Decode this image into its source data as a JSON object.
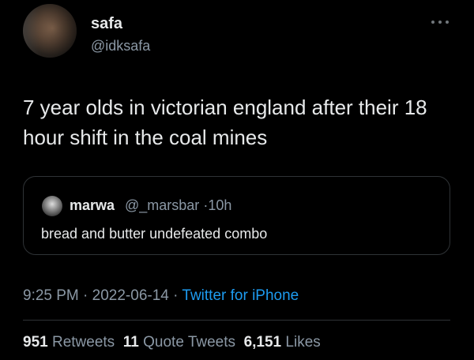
{
  "author": {
    "display_name": "safa",
    "handle": "@idksafa"
  },
  "tweet": {
    "text": "7 year olds in victorian england after their 18 hour shift in the coal mines"
  },
  "quoted_tweet": {
    "display_name": "marwa",
    "handle": "@_marsbar",
    "time_ago": "10h",
    "text": "bread and butter undefeated combo"
  },
  "meta": {
    "time": "9:25 PM",
    "date": "2022-06-14",
    "source": "Twitter for iPhone",
    "separator": "·"
  },
  "stats": {
    "retweets_count": "951",
    "retweets_label": "Retweets",
    "quotes_count": "11",
    "quotes_label": "Quote Tweets",
    "likes_count": "6,151",
    "likes_label": "Likes"
  },
  "icons": {
    "more": "more-options-icon"
  },
  "colors": {
    "background": "#000000",
    "text": "#e7e9ea",
    "muted": "#8b98a5",
    "link": "#1d9bf0",
    "border": "#2f3336"
  }
}
